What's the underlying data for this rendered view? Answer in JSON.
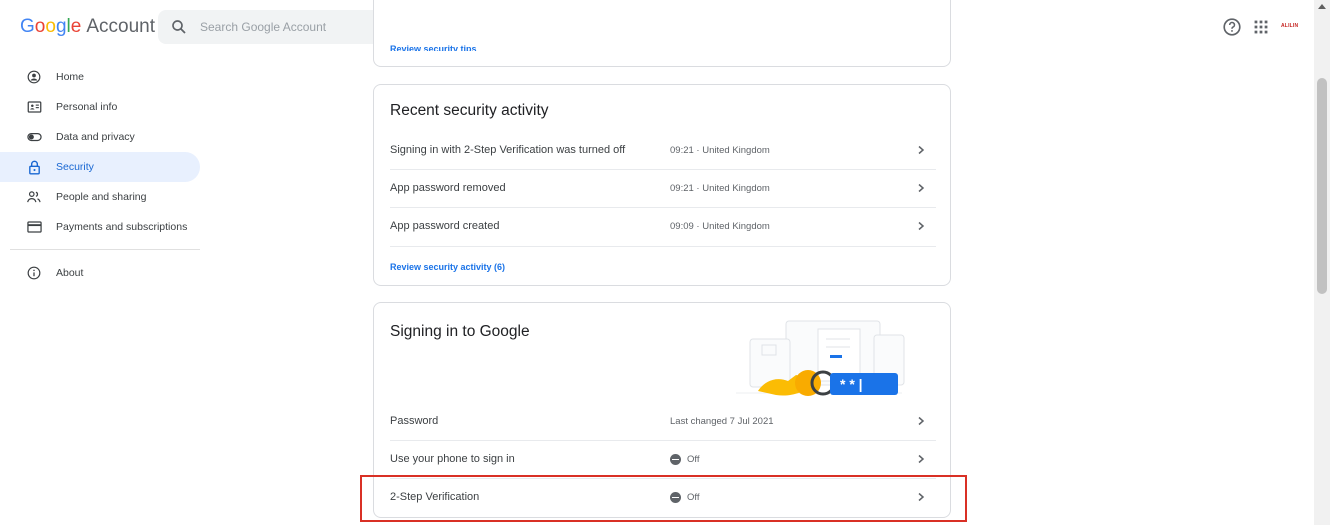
{
  "header": {
    "logo_word": [
      "G",
      "o",
      "o",
      "g",
      "l",
      "e"
    ],
    "logo_account": "Account",
    "search_placeholder": "Search Google Account",
    "user_badge": "ALILIN"
  },
  "sidebar": {
    "items": [
      {
        "label": "Home",
        "icon": "home-icon"
      },
      {
        "label": "Personal info",
        "icon": "id-card-icon"
      },
      {
        "label": "Data and privacy",
        "icon": "toggle-icon"
      },
      {
        "label": "Security",
        "icon": "lock-icon",
        "active": true
      },
      {
        "label": "People and sharing",
        "icon": "people-icon"
      },
      {
        "label": "Payments and subscriptions",
        "icon": "card-icon"
      }
    ],
    "about": "About"
  },
  "top_card": {
    "link": "Review security tips"
  },
  "activity_card": {
    "title": "Recent security activity",
    "rows": [
      {
        "label": "Signing in with 2-Step Verification was turned off",
        "value": "09:21 · United Kingdom"
      },
      {
        "label": "App password removed",
        "value": "09:21 · United Kingdom"
      },
      {
        "label": "App password created",
        "value": "09:09 · United Kingdom"
      }
    ],
    "link": "Review security activity (6)"
  },
  "signin_card": {
    "title": "Signing in to Google",
    "illustration_text": "* * |",
    "rows": [
      {
        "label": "Password",
        "value": "Last changed 7 Jul 2021"
      },
      {
        "label": "Use your phone to sign in",
        "value": "Off",
        "status": "off"
      },
      {
        "label": "2-Step Verification",
        "value": "Off",
        "status": "off",
        "highlighted": true
      }
    ]
  },
  "colors": {
    "accent": "#1a73e8",
    "active_bg": "#e8f0fe",
    "highlight_border": "#d93025"
  }
}
